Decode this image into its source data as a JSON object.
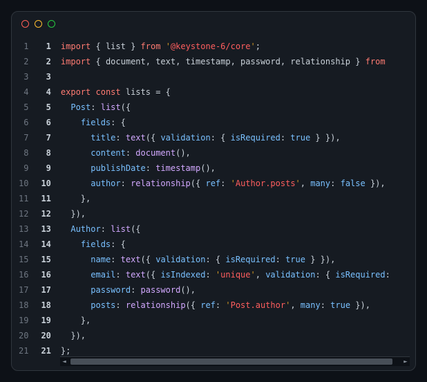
{
  "chart_data": null,
  "window": {
    "traffic": [
      "red",
      "yellow",
      "green"
    ]
  },
  "code": {
    "lines": [
      {
        "n": 1,
        "tokens": [
          [
            "kw",
            "import"
          ],
          [
            "pun",
            " { "
          ],
          [
            "var",
            "list"
          ],
          [
            "pun",
            " } "
          ],
          [
            "kw",
            "from"
          ],
          [
            "pun",
            " "
          ],
          [
            "str",
            "'"
          ],
          [
            "str2",
            "@keystone-6/core"
          ],
          [
            "str",
            "'"
          ],
          [
            "pun",
            ";"
          ]
        ]
      },
      {
        "n": 2,
        "tokens": [
          [
            "kw",
            "import"
          ],
          [
            "pun",
            " { "
          ],
          [
            "var",
            "document"
          ],
          [
            "pun",
            ", "
          ],
          [
            "var",
            "text"
          ],
          [
            "pun",
            ", "
          ],
          [
            "var",
            "timestamp"
          ],
          [
            "pun",
            ", "
          ],
          [
            "var",
            "password"
          ],
          [
            "pun",
            ", "
          ],
          [
            "var",
            "relationship"
          ],
          [
            "pun",
            " } "
          ],
          [
            "kw",
            "from"
          ]
        ]
      },
      {
        "n": 3,
        "tokens": []
      },
      {
        "n": 4,
        "tokens": [
          [
            "kw",
            "export"
          ],
          [
            "pun",
            " "
          ],
          [
            "kw",
            "const"
          ],
          [
            "pun",
            " "
          ],
          [
            "var",
            "lists"
          ],
          [
            "pun",
            " = {"
          ]
        ]
      },
      {
        "n": 5,
        "tokens": [
          [
            "pun",
            "  "
          ],
          [
            "prop",
            "Post"
          ],
          [
            "pun",
            ": "
          ],
          [
            "fn",
            "list"
          ],
          [
            "pun",
            "({"
          ]
        ]
      },
      {
        "n": 6,
        "tokens": [
          [
            "pun",
            "    "
          ],
          [
            "prop",
            "fields"
          ],
          [
            "pun",
            ": {"
          ]
        ]
      },
      {
        "n": 7,
        "tokens": [
          [
            "pun",
            "      "
          ],
          [
            "prop",
            "title"
          ],
          [
            "pun",
            ": "
          ],
          [
            "fn",
            "text"
          ],
          [
            "pun",
            "({ "
          ],
          [
            "prop",
            "validation"
          ],
          [
            "pun",
            ": { "
          ],
          [
            "prop",
            "isRequired"
          ],
          [
            "pun",
            ": "
          ],
          [
            "bool",
            "true"
          ],
          [
            "pun",
            " } }),"
          ]
        ]
      },
      {
        "n": 8,
        "tokens": [
          [
            "pun",
            "      "
          ],
          [
            "prop",
            "content"
          ],
          [
            "pun",
            ": "
          ],
          [
            "fn",
            "document"
          ],
          [
            "pun",
            "(),"
          ]
        ]
      },
      {
        "n": 9,
        "tokens": [
          [
            "pun",
            "      "
          ],
          [
            "prop",
            "publishDate"
          ],
          [
            "pun",
            ": "
          ],
          [
            "fn",
            "timestamp"
          ],
          [
            "pun",
            "(),"
          ]
        ]
      },
      {
        "n": 10,
        "tokens": [
          [
            "pun",
            "      "
          ],
          [
            "prop",
            "author"
          ],
          [
            "pun",
            ": "
          ],
          [
            "fn",
            "relationship"
          ],
          [
            "pun",
            "({ "
          ],
          [
            "prop",
            "ref"
          ],
          [
            "pun",
            ": "
          ],
          [
            "str",
            "'"
          ],
          [
            "str2",
            "Author.posts"
          ],
          [
            "str",
            "'"
          ],
          [
            "pun",
            ", "
          ],
          [
            "prop",
            "many"
          ],
          [
            "pun",
            ": "
          ],
          [
            "bool",
            "false"
          ],
          [
            "pun",
            " }),"
          ]
        ]
      },
      {
        "n": 11,
        "tokens": [
          [
            "pun",
            "    },"
          ]
        ]
      },
      {
        "n": 12,
        "tokens": [
          [
            "pun",
            "  }),"
          ]
        ]
      },
      {
        "n": 13,
        "tokens": [
          [
            "pun",
            "  "
          ],
          [
            "prop",
            "Author"
          ],
          [
            "pun",
            ": "
          ],
          [
            "fn",
            "list"
          ],
          [
            "pun",
            "({"
          ]
        ]
      },
      {
        "n": 14,
        "tokens": [
          [
            "pun",
            "    "
          ],
          [
            "prop",
            "fields"
          ],
          [
            "pun",
            ": {"
          ]
        ]
      },
      {
        "n": 15,
        "tokens": [
          [
            "pun",
            "      "
          ],
          [
            "prop",
            "name"
          ],
          [
            "pun",
            ": "
          ],
          [
            "fn",
            "text"
          ],
          [
            "pun",
            "({ "
          ],
          [
            "prop",
            "validation"
          ],
          [
            "pun",
            ": { "
          ],
          [
            "prop",
            "isRequired"
          ],
          [
            "pun",
            ": "
          ],
          [
            "bool",
            "true"
          ],
          [
            "pun",
            " } }),"
          ]
        ]
      },
      {
        "n": 16,
        "tokens": [
          [
            "pun",
            "      "
          ],
          [
            "prop",
            "email"
          ],
          [
            "pun",
            ": "
          ],
          [
            "fn",
            "text"
          ],
          [
            "pun",
            "({ "
          ],
          [
            "prop",
            "isIndexed"
          ],
          [
            "pun",
            ": "
          ],
          [
            "str",
            "'"
          ],
          [
            "str2",
            "unique"
          ],
          [
            "str",
            "'"
          ],
          [
            "pun",
            ", "
          ],
          [
            "prop",
            "validation"
          ],
          [
            "pun",
            ": { "
          ],
          [
            "prop",
            "isRequired"
          ],
          [
            "pun",
            ":"
          ]
        ]
      },
      {
        "n": 17,
        "tokens": [
          [
            "pun",
            "      "
          ],
          [
            "prop",
            "password"
          ],
          [
            "pun",
            ": "
          ],
          [
            "fn",
            "password"
          ],
          [
            "pun",
            "(),"
          ]
        ]
      },
      {
        "n": 18,
        "tokens": [
          [
            "pun",
            "      "
          ],
          [
            "prop",
            "posts"
          ],
          [
            "pun",
            ": "
          ],
          [
            "fn",
            "relationship"
          ],
          [
            "pun",
            "({ "
          ],
          [
            "prop",
            "ref"
          ],
          [
            "pun",
            ": "
          ],
          [
            "str",
            "'"
          ],
          [
            "str2",
            "Post.author"
          ],
          [
            "str",
            "'"
          ],
          [
            "pun",
            ", "
          ],
          [
            "prop",
            "many"
          ],
          [
            "pun",
            ": "
          ],
          [
            "bool",
            "true"
          ],
          [
            "pun",
            " }),"
          ]
        ]
      },
      {
        "n": 19,
        "tokens": [
          [
            "pun",
            "    },"
          ]
        ]
      },
      {
        "n": 20,
        "tokens": [
          [
            "pun",
            "  }),"
          ]
        ]
      },
      {
        "n": 21,
        "tokens": [
          [
            "pun",
            "};"
          ]
        ]
      }
    ]
  },
  "scrollbar": {
    "thumb_left_pct": 3,
    "thumb_width_pct": 92
  }
}
